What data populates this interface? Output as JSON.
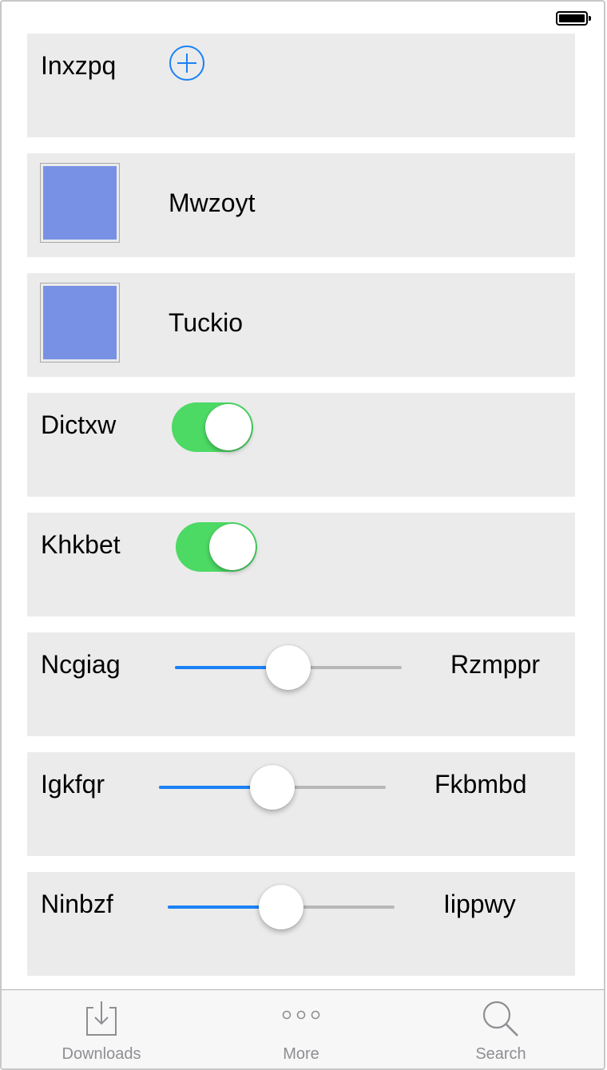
{
  "status_bar": {
    "battery_icon": "battery-full-icon"
  },
  "rows": {
    "row1": {
      "label": "Inxzpq",
      "icon": "add-circle-icon"
    },
    "row2": {
      "label": "Mwzoyt",
      "swatch_color": "#7891e4"
    },
    "row3": {
      "label": "Tuckio",
      "swatch_color": "#7891e4"
    },
    "row4": {
      "label": "Dictxw",
      "toggle_on": true
    },
    "row5": {
      "label": "Khkbet",
      "toggle_on": true
    },
    "row6": {
      "label": "Ncgiag",
      "right_label": "Rzmppr",
      "slider_value": 0.5
    },
    "row7": {
      "label": "Igkfqr",
      "right_label": "Fkbmbd",
      "slider_value": 0.5
    },
    "row8": {
      "label": "Ninbzf",
      "right_label": "Iippwy",
      "slider_value": 0.5
    }
  },
  "tab_bar": {
    "tabs": [
      {
        "label": "Downloads",
        "icon": "downloads-icon"
      },
      {
        "label": "More",
        "icon": "more-icon"
      },
      {
        "label": "Search",
        "icon": "search-icon"
      }
    ]
  },
  "colors": {
    "row_background": "#ebebeb",
    "toggle_on": "#4cd964",
    "slider_fill": "#1a82f6",
    "slider_track": "#b7b7b7",
    "accent": "#1a82f6",
    "tab_label": "#8e8e93"
  }
}
